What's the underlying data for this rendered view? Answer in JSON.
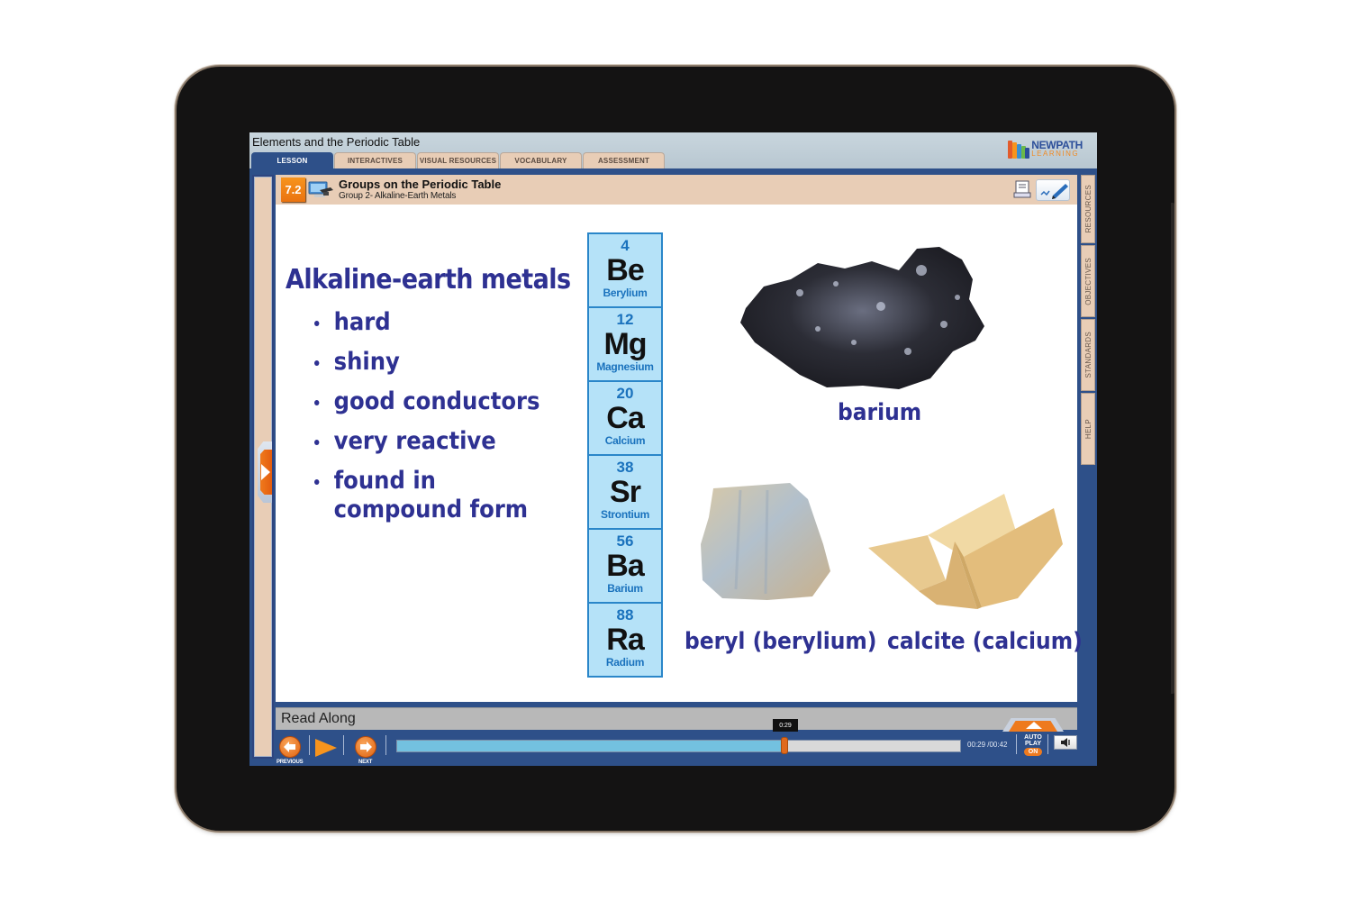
{
  "app": {
    "title": "Elements and the Periodic Table",
    "logo": {
      "line1": "NEWPATH",
      "line2": "LEARNING"
    }
  },
  "tabs": [
    {
      "label": "LESSON",
      "active": true
    },
    {
      "label": "INTERACTIVES",
      "active": false
    },
    {
      "label": "VISUAL RESOURCES",
      "active": false
    },
    {
      "label": "VOCABULARY",
      "active": false
    },
    {
      "label": "ASSESSMENT",
      "active": false
    }
  ],
  "lesson": {
    "number": "7.2",
    "title": "Groups on the Periodic Table",
    "subtitle": "Group 2- Alkaline-Earth Metals",
    "icons": [
      "lesson-computer-icon",
      "print-icon",
      "notes-icon"
    ]
  },
  "side_tabs": [
    "RESOURCES",
    "OBJECTIVES",
    "STANDARDS",
    "HELP"
  ],
  "slide": {
    "heading": "Alkaline-earth metals",
    "bullets": [
      "hard",
      "shiny",
      "good conductors",
      "very reactive",
      "found in compound form"
    ],
    "elements": [
      {
        "number": "4",
        "symbol": "Be",
        "name": "Berylium"
      },
      {
        "number": "12",
        "symbol": "Mg",
        "name": "Magnesium"
      },
      {
        "number": "20",
        "symbol": "Ca",
        "name": "Calcium"
      },
      {
        "number": "38",
        "symbol": "Sr",
        "name": "Strontium"
      },
      {
        "number": "56",
        "symbol": "Ba",
        "name": "Barium"
      },
      {
        "number": "88",
        "symbol": "Ra",
        "name": "Radium"
      }
    ],
    "images": [
      {
        "caption": "barium"
      },
      {
        "caption": "beryl (berylium)"
      },
      {
        "caption": "calcite (calcium)"
      }
    ]
  },
  "player": {
    "read_along_label": "Read Along",
    "previous_label": "PREVIOUS",
    "next_label": "NEXT",
    "tooltip": "0:29",
    "time_display": "00:29 /00:42",
    "progress_fraction": 0.69,
    "autoplay_label_1": "AUTO",
    "autoplay_label_2": "PLAY",
    "autoplay_state": "ON",
    "mute_icon": "speaker-icon"
  },
  "colors": {
    "accent_orange": "#f7941d",
    "nav_blue": "#2e5089",
    "text_indigo": "#2e3192",
    "tab_beige": "#e8cdb6",
    "element_cell": "#b5e2f8"
  }
}
